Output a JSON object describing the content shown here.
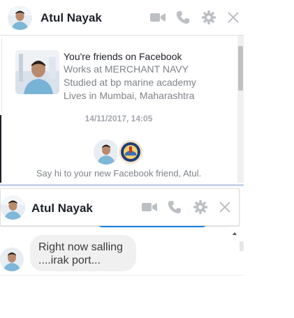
{
  "chat_top": {
    "name": "Atul Nayak",
    "profile": {
      "line1": "You're friends on Facebook",
      "line2": "Works at MERCHANT NAVY",
      "line3": "Studied at bp marine academy",
      "line4": "Lives in Mumbai, Maharashtra"
    },
    "timestamp": "14/11/2017, 14:05",
    "say_hi": "Say hi to your new Facebook friend, Atul."
  },
  "chat_bottom": {
    "name": "Atul Nayak",
    "message_line1": "Right now salling",
    "message_line2": "....irak port..."
  },
  "icons": {
    "video": "video-camera-icon",
    "call": "phone-icon",
    "settings": "gear-icon",
    "close": "close-icon"
  },
  "colors": {
    "icon_gray": "#bcc0c4",
    "bubble_bg": "#f1f0f0",
    "accent_blue": "#1f8df0"
  }
}
